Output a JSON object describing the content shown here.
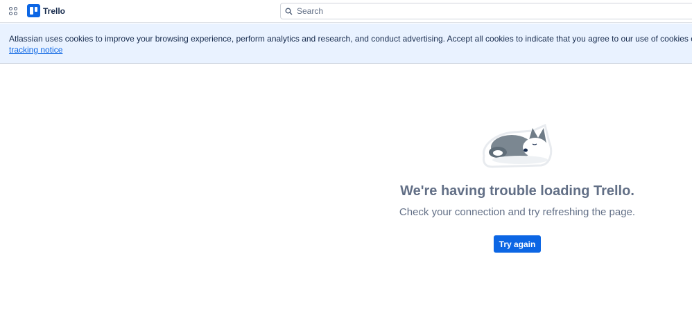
{
  "header": {
    "brand": "Trello",
    "search_placeholder": "Search"
  },
  "cookie_banner": {
    "text": "Atlassian uses cookies to improve your browsing experience, perform analytics and research, and conduct advertising. Accept all cookies to indicate that you agree to our use of cookies on yo",
    "link": "tracking notice"
  },
  "error": {
    "title": "We're having trouble loading Trello.",
    "subtitle": "Check your connection and try refreshing the page.",
    "button": "Try again"
  },
  "colors": {
    "accent": "#0c66e4",
    "banner": "#e9f2ff"
  }
}
